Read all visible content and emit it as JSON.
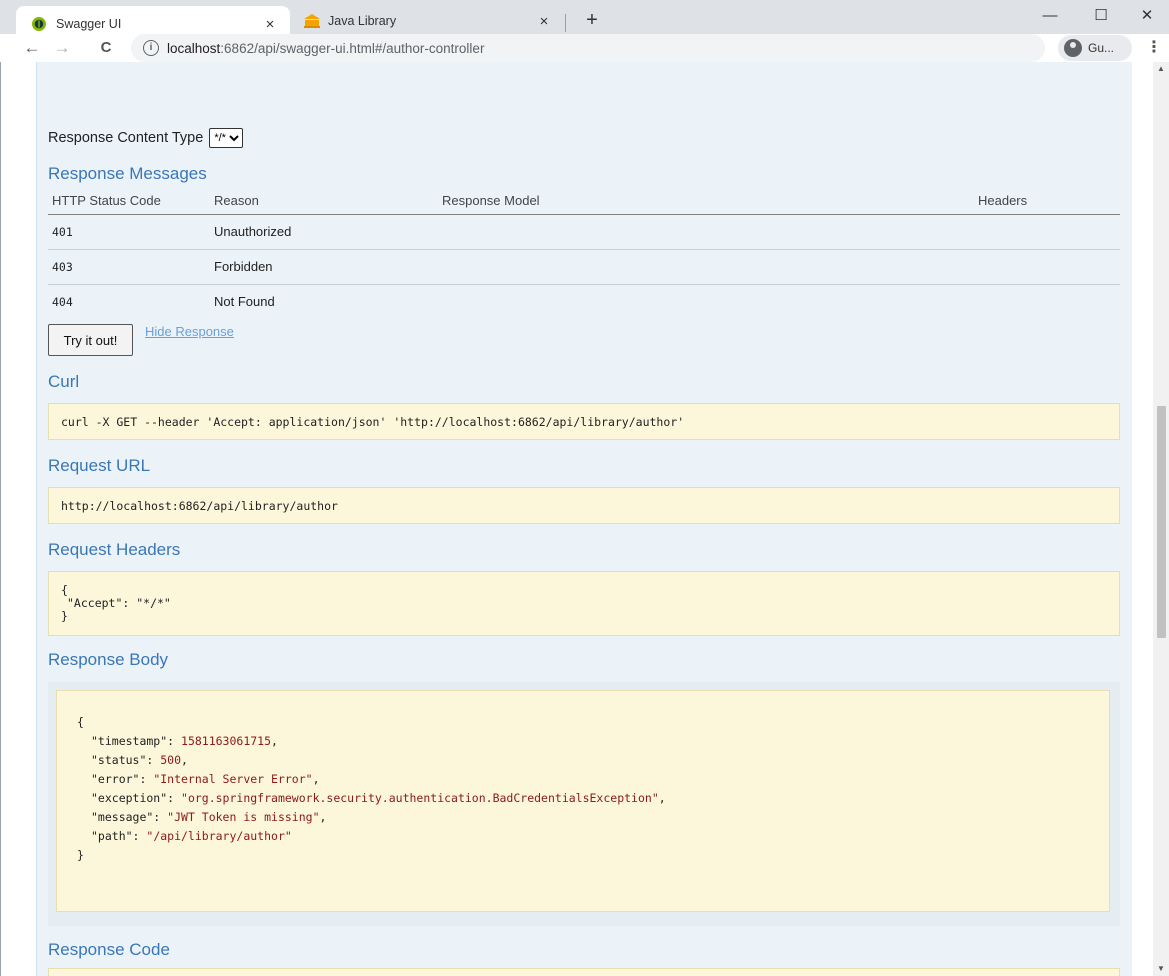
{
  "browser": {
    "tabs": [
      {
        "title": "Swagger UI",
        "active": true,
        "close": "×"
      },
      {
        "title": "Java Library",
        "active": false,
        "close": "×"
      }
    ],
    "new_tab": "+",
    "window_controls": {
      "minimize": "—",
      "maximize": "☐",
      "close": "✕"
    },
    "nav": {
      "back": "←",
      "forward": "→",
      "reload": "C"
    },
    "address": {
      "info": "i",
      "host": "localhost",
      "path": ":6862/api/swagger-ui.html#/author-controller"
    },
    "profile_label": "Gu...",
    "menu": "⋮"
  },
  "page": {
    "response_content_type": {
      "label": "Response Content Type",
      "selected": "*/*"
    },
    "response_messages": {
      "heading": "Response Messages",
      "columns": [
        "HTTP Status Code",
        "Reason",
        "Response Model",
        "Headers"
      ],
      "rows": [
        {
          "code": "401",
          "reason": "Unauthorized"
        },
        {
          "code": "403",
          "reason": "Forbidden"
        },
        {
          "code": "404",
          "reason": "Not Found"
        }
      ]
    },
    "try_button": "Try it out!",
    "hide_response": "Hide Response",
    "curl": {
      "heading": "Curl",
      "value": "curl -X GET --header 'Accept: application/json' 'http://localhost:6862/api/library/author'"
    },
    "request_url": {
      "heading": "Request URL",
      "value": "http://localhost:6862/api/library/author"
    },
    "request_headers": {
      "heading": "Request Headers",
      "open": "{",
      "line": "\"Accept\": \"*/*\"",
      "close": "}"
    },
    "response_body": {
      "heading": "Response Body",
      "open": "{",
      "close": "}",
      "fields": {
        "timestamp_key": "\"timestamp\": ",
        "timestamp_val": "1581163061715",
        "status_key": "\"status\": ",
        "status_val": "500",
        "error_key": "\"error\": ",
        "error_val": "\"Internal Server Error\"",
        "exception_key": "\"exception\": ",
        "exception_val": "\"org.springframework.security.authentication.BadCredentialsException\"",
        "message_key": "\"message\": ",
        "message_val": "\"JWT Token is missing\"",
        "path_key": "\"path\": ",
        "path_val": "\"/api/library/author\""
      }
    },
    "response_code": {
      "heading": "Response Code"
    }
  }
}
